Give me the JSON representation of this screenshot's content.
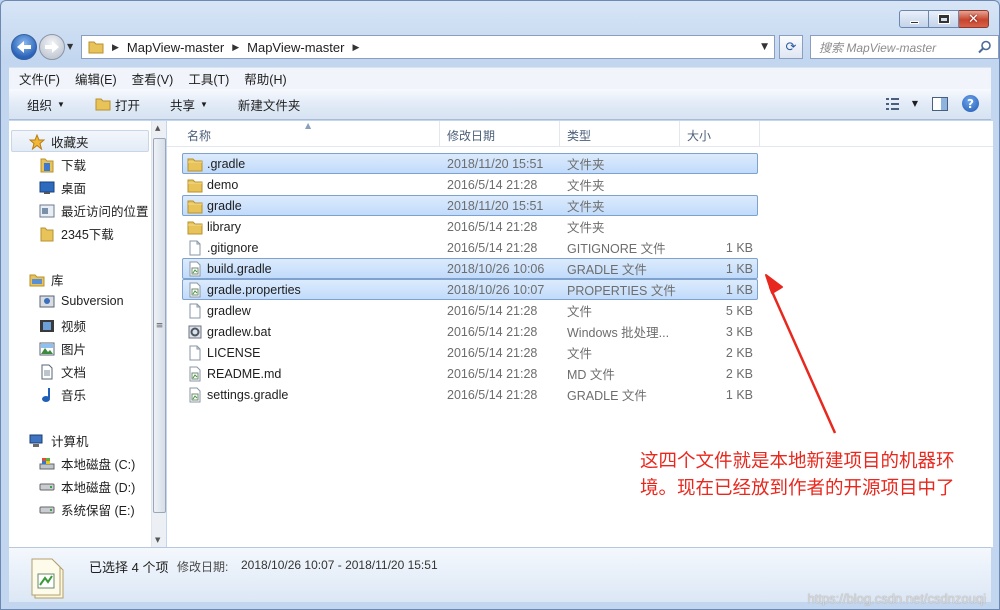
{
  "address": {
    "crumbs": [
      "MapView-master",
      "MapView-master"
    ]
  },
  "search": {
    "placeholder": "搜索 MapView-master"
  },
  "menu": [
    "文件(F)",
    "编辑(E)",
    "查看(V)",
    "工具(T)",
    "帮助(H)"
  ],
  "commands": {
    "organize": "组织",
    "open": "打开",
    "share": "共享",
    "new_folder": "新建文件夹"
  },
  "nav": {
    "favorites_label": "收藏夹",
    "favorites": [
      "下载",
      "桌面",
      "最近访问的位置",
      "2345下载"
    ],
    "libraries_label": "库",
    "libraries": [
      "Subversion",
      "视频",
      "图片",
      "文档",
      "音乐"
    ],
    "computer_label": "计算机",
    "drives": [
      "本地磁盘 (C:)",
      "本地磁盘 (D:)",
      "系统保留 (E:)"
    ]
  },
  "columns": {
    "name": "名称",
    "date": "修改日期",
    "type": "类型",
    "size": "大小"
  },
  "files": [
    {
      "name": ".gradle",
      "date": "2018/11/20 15:51",
      "type": "文件夹",
      "size": "",
      "icon": "folder-icon",
      "selected": true
    },
    {
      "name": "demo",
      "date": "2016/5/14 21:28",
      "type": "文件夹",
      "size": "",
      "icon": "folder-icon",
      "selected": false
    },
    {
      "name": "gradle",
      "date": "2018/11/20 15:51",
      "type": "文件夹",
      "size": "",
      "icon": "folder-icon",
      "selected": true
    },
    {
      "name": "library",
      "date": "2016/5/14 21:28",
      "type": "文件夹",
      "size": "",
      "icon": "folder-icon",
      "selected": false
    },
    {
      "name": ".gitignore",
      "date": "2016/5/14 21:28",
      "type": "GITIGNORE 文件",
      "size": "1 KB",
      "icon": "file-icon",
      "selected": false
    },
    {
      "name": "build.gradle",
      "date": "2018/10/26 10:06",
      "type": "GRADLE 文件",
      "size": "1 KB",
      "icon": "gradle-file-icon",
      "selected": true
    },
    {
      "name": "gradle.properties",
      "date": "2018/10/26 10:07",
      "type": "PROPERTIES 文件",
      "size": "1 KB",
      "icon": "gradle-file-icon",
      "selected": true
    },
    {
      "name": "gradlew",
      "date": "2016/5/14 21:28",
      "type": "文件",
      "size": "5 KB",
      "icon": "file-icon",
      "selected": false
    },
    {
      "name": "gradlew.bat",
      "date": "2016/5/14 21:28",
      "type": "Windows 批处理...",
      "size": "3 KB",
      "icon": "batch-file-icon",
      "selected": false
    },
    {
      "name": "LICENSE",
      "date": "2016/5/14 21:28",
      "type": "文件",
      "size": "2 KB",
      "icon": "file-icon",
      "selected": false
    },
    {
      "name": "README.md",
      "date": "2016/5/14 21:28",
      "type": "MD 文件",
      "size": "2 KB",
      "icon": "gradle-file-icon",
      "selected": false
    },
    {
      "name": "settings.gradle",
      "date": "2016/5/14 21:28",
      "type": "GRADLE 文件",
      "size": "1 KB",
      "icon": "gradle-file-icon",
      "selected": false
    }
  ],
  "status": {
    "selected": "已选择 4 个项",
    "modified_label": "修改日期:",
    "modified_range": "2018/10/26 10:07 - 2018/11/20 15:51"
  },
  "annotation": "这四个文件就是本地新建项目的机器环境。现在已经放到作者的开源项目中了",
  "watermark": "https://blog.csdn.net/csdnzouqi"
}
